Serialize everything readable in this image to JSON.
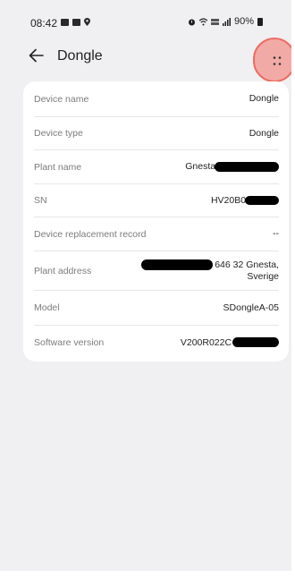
{
  "status_bar": {
    "time": "08:42",
    "battery": "90%",
    "left_icons": [
      "image-icon",
      "mail-icon",
      "location-pin-icon"
    ],
    "right_icons": [
      "alarm-icon",
      "wifi-icon",
      "volte-icon",
      "signal-icon",
      "battery-icon"
    ]
  },
  "header": {
    "back_icon": "arrow-left-icon",
    "title": "Dongle",
    "more_icon": "more-dots-icon"
  },
  "details": [
    {
      "label": "Device name",
      "value": "Dongle"
    },
    {
      "label": "Device type",
      "value": "Dongle"
    },
    {
      "label": "Plant name",
      "value": "Gnesta"
    },
    {
      "label": "SN",
      "value": "HV20B0"
    },
    {
      "label": "Device replacement record",
      "value": "--"
    },
    {
      "label": "Plant address",
      "value": "646 32 Gnesta,",
      "value2": "Sverige"
    },
    {
      "label": "Model",
      "value": "SDongleA-05"
    },
    {
      "label": "Software version",
      "value": "V200R022C"
    }
  ],
  "colors": {
    "background": "#f0f0f2",
    "card": "#ffffff",
    "highlight": "#ec6d64"
  }
}
